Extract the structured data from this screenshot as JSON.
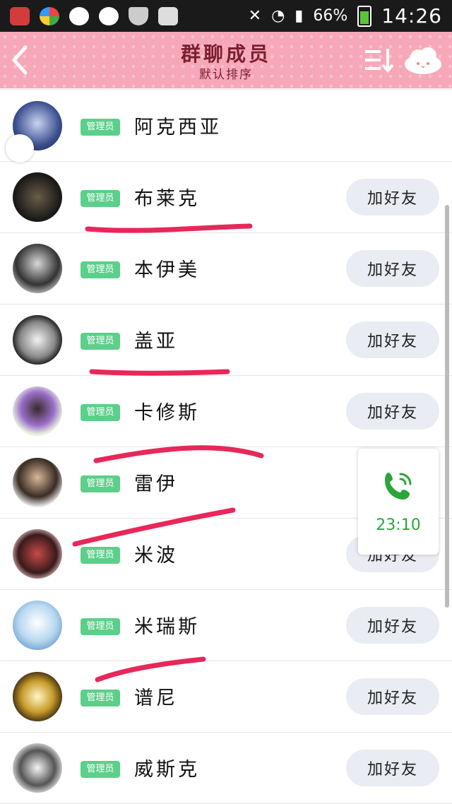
{
  "statusbar": {
    "battery": "66%",
    "time": "14:26"
  },
  "header": {
    "back_icon": "back-arrow",
    "title": "群聊成员",
    "subtitle": "默认排序",
    "sort_icon": "sort-icon",
    "menu_icon": "cloud-face-icon"
  },
  "colors": {
    "header_bg": "#f7a8b8",
    "badge": "#5ccf8a",
    "call_green": "#2aa63a",
    "annotation": "#e8275a"
  },
  "members": [
    {
      "name": "阿克西亚",
      "badge": "管理员",
      "action": ""
    },
    {
      "name": "布莱克",
      "badge": "管理员",
      "action": "加好友"
    },
    {
      "name": "本伊美",
      "badge": "管理员",
      "action": "加好友"
    },
    {
      "name": "盖亚",
      "badge": "管理员",
      "action": "加好友"
    },
    {
      "name": "卡修斯",
      "badge": "管理员",
      "action": "加好友"
    },
    {
      "name": "雷伊",
      "badge": "管理员",
      "action": ""
    },
    {
      "name": "米波",
      "badge": "管理员",
      "action": "加好友"
    },
    {
      "name": "米瑞斯",
      "badge": "管理员",
      "action": "加好友"
    },
    {
      "name": "谱尼",
      "badge": "管理员",
      "action": "加好友"
    },
    {
      "name": "威斯克",
      "badge": "管理员",
      "action": "加好友"
    }
  ],
  "call_widget": {
    "icon": "phone-call-icon",
    "duration": "23:10"
  }
}
